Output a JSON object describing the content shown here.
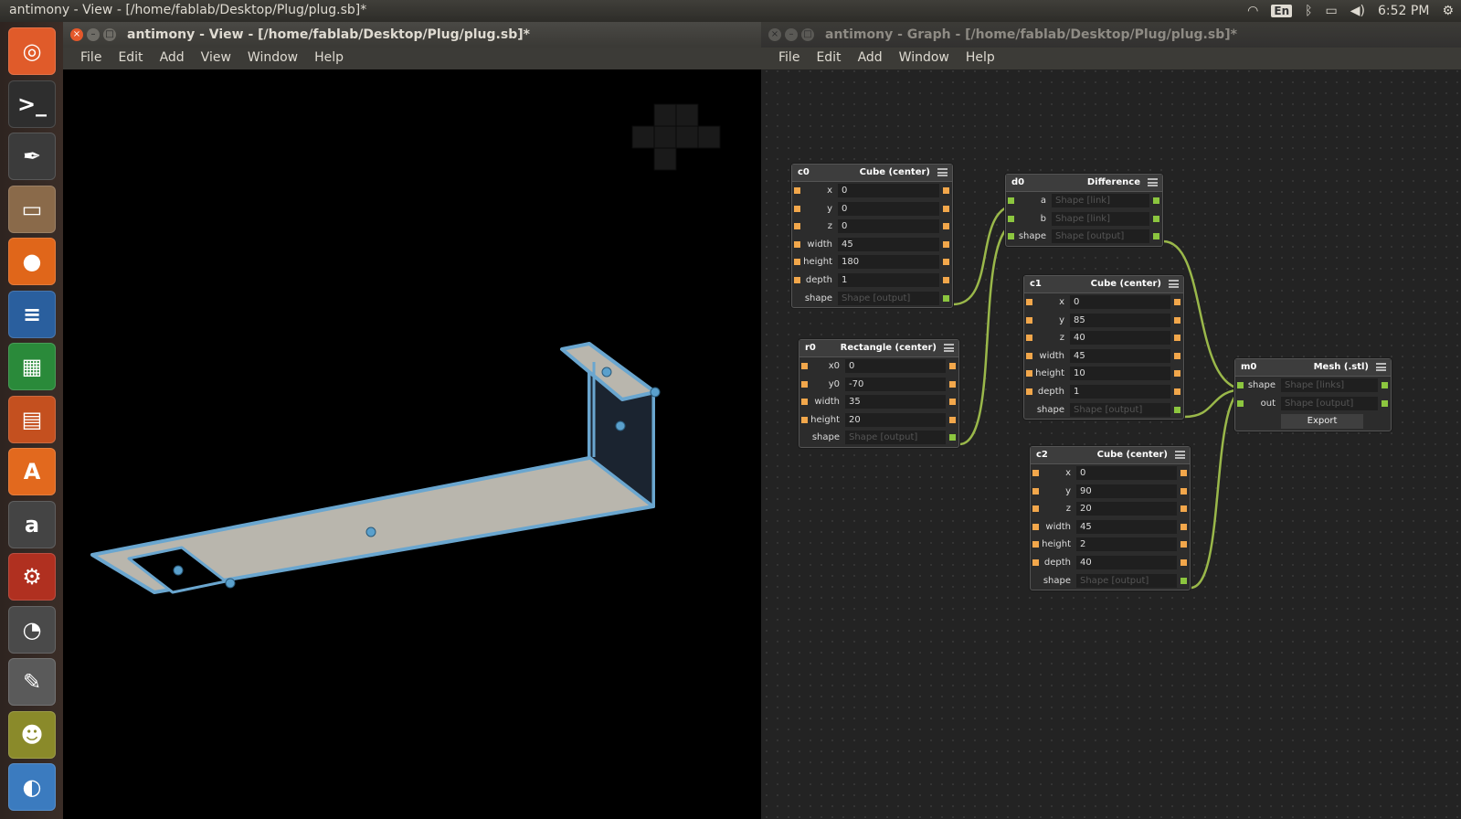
{
  "topbar": {
    "title": "antimony - View - [/home/fablab/Desktop/Plug/plug.sb]*",
    "keyboard": "En",
    "time": "6:52 PM"
  },
  "launcher": {
    "items": [
      {
        "name": "ubuntu-dash-icon",
        "glyph": "◎",
        "color": "#e05b2a"
      },
      {
        "name": "terminal-icon",
        "glyph": ">_",
        "color": "#2e2e2e"
      },
      {
        "name": "inkscape-icon",
        "glyph": "✒",
        "color": "#3b3b3b"
      },
      {
        "name": "files-icon",
        "glyph": "▭",
        "color": "#8a6a4a"
      },
      {
        "name": "firefox-icon",
        "glyph": "●",
        "color": "#e0661a"
      },
      {
        "name": "writer-icon",
        "glyph": "≡",
        "color": "#2a5f9e"
      },
      {
        "name": "calc-icon",
        "glyph": "▦",
        "color": "#2a8a3a"
      },
      {
        "name": "impress-icon",
        "glyph": "▤",
        "color": "#c4501f"
      },
      {
        "name": "software-center-icon",
        "glyph": "A",
        "color": "#e2691e"
      },
      {
        "name": "amazon-icon",
        "glyph": "a",
        "color": "#444"
      },
      {
        "name": "system-settings-icon",
        "glyph": "⚙",
        "color": "#b03020"
      },
      {
        "name": "disk-usage-icon",
        "glyph": "◔",
        "color": "#4a4a4a"
      },
      {
        "name": "gimp-icon",
        "glyph": "✎",
        "color": "#5a5a5a"
      },
      {
        "name": "app-icon",
        "glyph": "☻",
        "color": "#8a8a2a"
      },
      {
        "name": "eclipse-icon",
        "glyph": "◐",
        "color": "#3b7bbf"
      }
    ]
  },
  "view_window": {
    "title": "antimony - View - [/home/fablab/Desktop/Plug/plug.sb]*",
    "menus": [
      "File",
      "Edit",
      "Add",
      "View",
      "Window",
      "Help"
    ]
  },
  "graph_window": {
    "title": "antimony - Graph - [/home/fablab/Desktop/Plug/plug.sb]*",
    "menus": [
      "File",
      "Edit",
      "Add",
      "Window",
      "Help"
    ]
  },
  "nodes": {
    "c0": {
      "name": "c0",
      "type": "Cube (center)",
      "rows": [
        {
          "label": "x",
          "value": "0"
        },
        {
          "label": "y",
          "value": "0"
        },
        {
          "label": "z",
          "value": "0"
        },
        {
          "label": "width",
          "value": "45"
        },
        {
          "label": "height",
          "value": "180"
        },
        {
          "label": "depth",
          "value": "1"
        },
        {
          "label": "shape",
          "value": "Shape [output]"
        }
      ]
    },
    "d0": {
      "name": "d0",
      "type": "Difference",
      "rows": [
        {
          "label": "a",
          "value": "Shape [link]"
        },
        {
          "label": "b",
          "value": "Shape [link]"
        },
        {
          "label": "shape",
          "value": "Shape [output]"
        }
      ]
    },
    "c1": {
      "name": "c1",
      "type": "Cube (center)",
      "rows": [
        {
          "label": "x",
          "value": "0"
        },
        {
          "label": "y",
          "value": "85"
        },
        {
          "label": "z",
          "value": "40"
        },
        {
          "label": "width",
          "value": "45"
        },
        {
          "label": "height",
          "value": "10"
        },
        {
          "label": "depth",
          "value": "1"
        },
        {
          "label": "shape",
          "value": "Shape [output]"
        }
      ]
    },
    "r0": {
      "name": "r0",
      "type": "Rectangle (center)",
      "rows": [
        {
          "label": "x0",
          "value": "0"
        },
        {
          "label": "y0",
          "value": "-70"
        },
        {
          "label": "width",
          "value": "35"
        },
        {
          "label": "height",
          "value": "20"
        },
        {
          "label": "shape",
          "value": "Shape [output]"
        }
      ]
    },
    "m0": {
      "name": "m0",
      "type": "Mesh (.stl)",
      "rows": [
        {
          "label": "shape",
          "value": "Shape [links]"
        },
        {
          "label": "out",
          "value": "Shape [output]"
        }
      ],
      "button": "Export"
    },
    "c2": {
      "name": "c2",
      "type": "Cube (center)",
      "rows": [
        {
          "label": "x",
          "value": "0"
        },
        {
          "label": "y",
          "value": "90"
        },
        {
          "label": "z",
          "value": "20"
        },
        {
          "label": "width",
          "value": "45"
        },
        {
          "label": "height",
          "value": "2"
        },
        {
          "label": "depth",
          "value": "40"
        },
        {
          "label": "shape",
          "value": "Shape [output]"
        }
      ]
    }
  },
  "colors": {
    "input_port": "#f2a74b",
    "shape_port": "#8cc63f",
    "wire": "#9ab84a",
    "model_face": "#b9b6ad",
    "model_edge": "#6aa6cf"
  }
}
